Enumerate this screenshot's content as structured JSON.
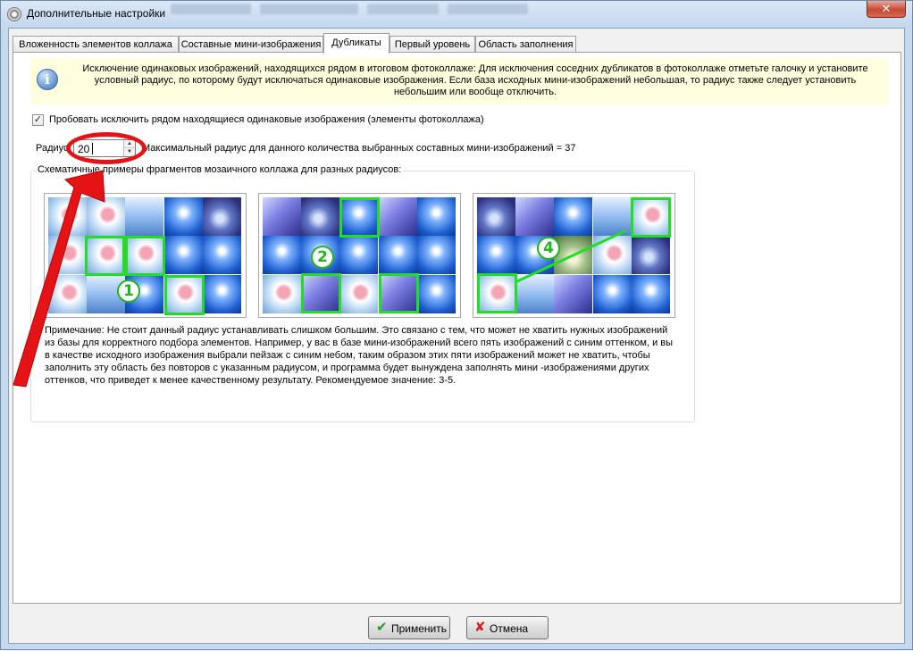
{
  "window": {
    "title": "Дополнительные настройки",
    "close_symbol": "✕"
  },
  "tabs": [
    {
      "label": "Вложенность элементов коллажа",
      "active": false
    },
    {
      "label": "Составные мини-изображения",
      "active": false
    },
    {
      "label": "Дубликаты",
      "active": true
    },
    {
      "label": "Первый уровень",
      "active": false
    },
    {
      "label": "Область заполнения",
      "active": false
    }
  ],
  "info": {
    "icon": "info-icon",
    "icon_glyph": "i",
    "text": "Исключение одинаковых изображений, находящихся рядом в итоговом фотоколлаже: Для исключения соседних дубликатов в фотоколлаже отметьте галочку и установите условный радиус, по которому будут исключаться одинаковые изображения. Если база исходных мини-изображений небольшая, то радиус также следует установить небольшим или вообще отключить."
  },
  "exclude_duplicates": {
    "checked": true,
    "check_glyph": "✓",
    "label": "Пробовать исключить рядом находящиеся одинаковые изображения (элементы фотоколлажа)"
  },
  "radius": {
    "label": "Радиус:",
    "value": "20",
    "up_glyph": "▲",
    "down_glyph": "▼",
    "max_note": "Максимальный радиус для данного количества выбранных составных мини-изображений = 37"
  },
  "examples": {
    "group_title": "Схематичные примеры фрагментов мозаичного коллажа для разных радиусов:",
    "items": [
      {
        "badge": "1"
      },
      {
        "badge": "2"
      },
      {
        "badge": "4"
      }
    ],
    "note": "Примечание: Не стоит данный радиус устанавливать слишком большим. Это связано с тем, что может не хватить нужных изображений из базы для корректного подбора элементов. Например, у вас в базе мини-изображений всего пять изображений с синим оттенком, и вы в качестве исходного изображения выбрали пейзаж с синим небом, таким образом этих пяти изображений может не хватить, чтобы заполнить эту область без повторов с указанным радиусом, и программа будет вынуждена заполнять мини -изображениями других оттенков, что приведет к менее качественному результату. Рекомендуемое значение: 3-5."
  },
  "buttons": {
    "apply": {
      "label": "Применить",
      "icon": "checkmark-icon",
      "glyph": "✔"
    },
    "cancel": {
      "label": "Отмена",
      "icon": "cross-icon",
      "glyph": "✘"
    }
  },
  "colors": {
    "annotation_red": "#e41316",
    "highlight_green": "#22dd22",
    "info_background": "#ffffe0"
  }
}
